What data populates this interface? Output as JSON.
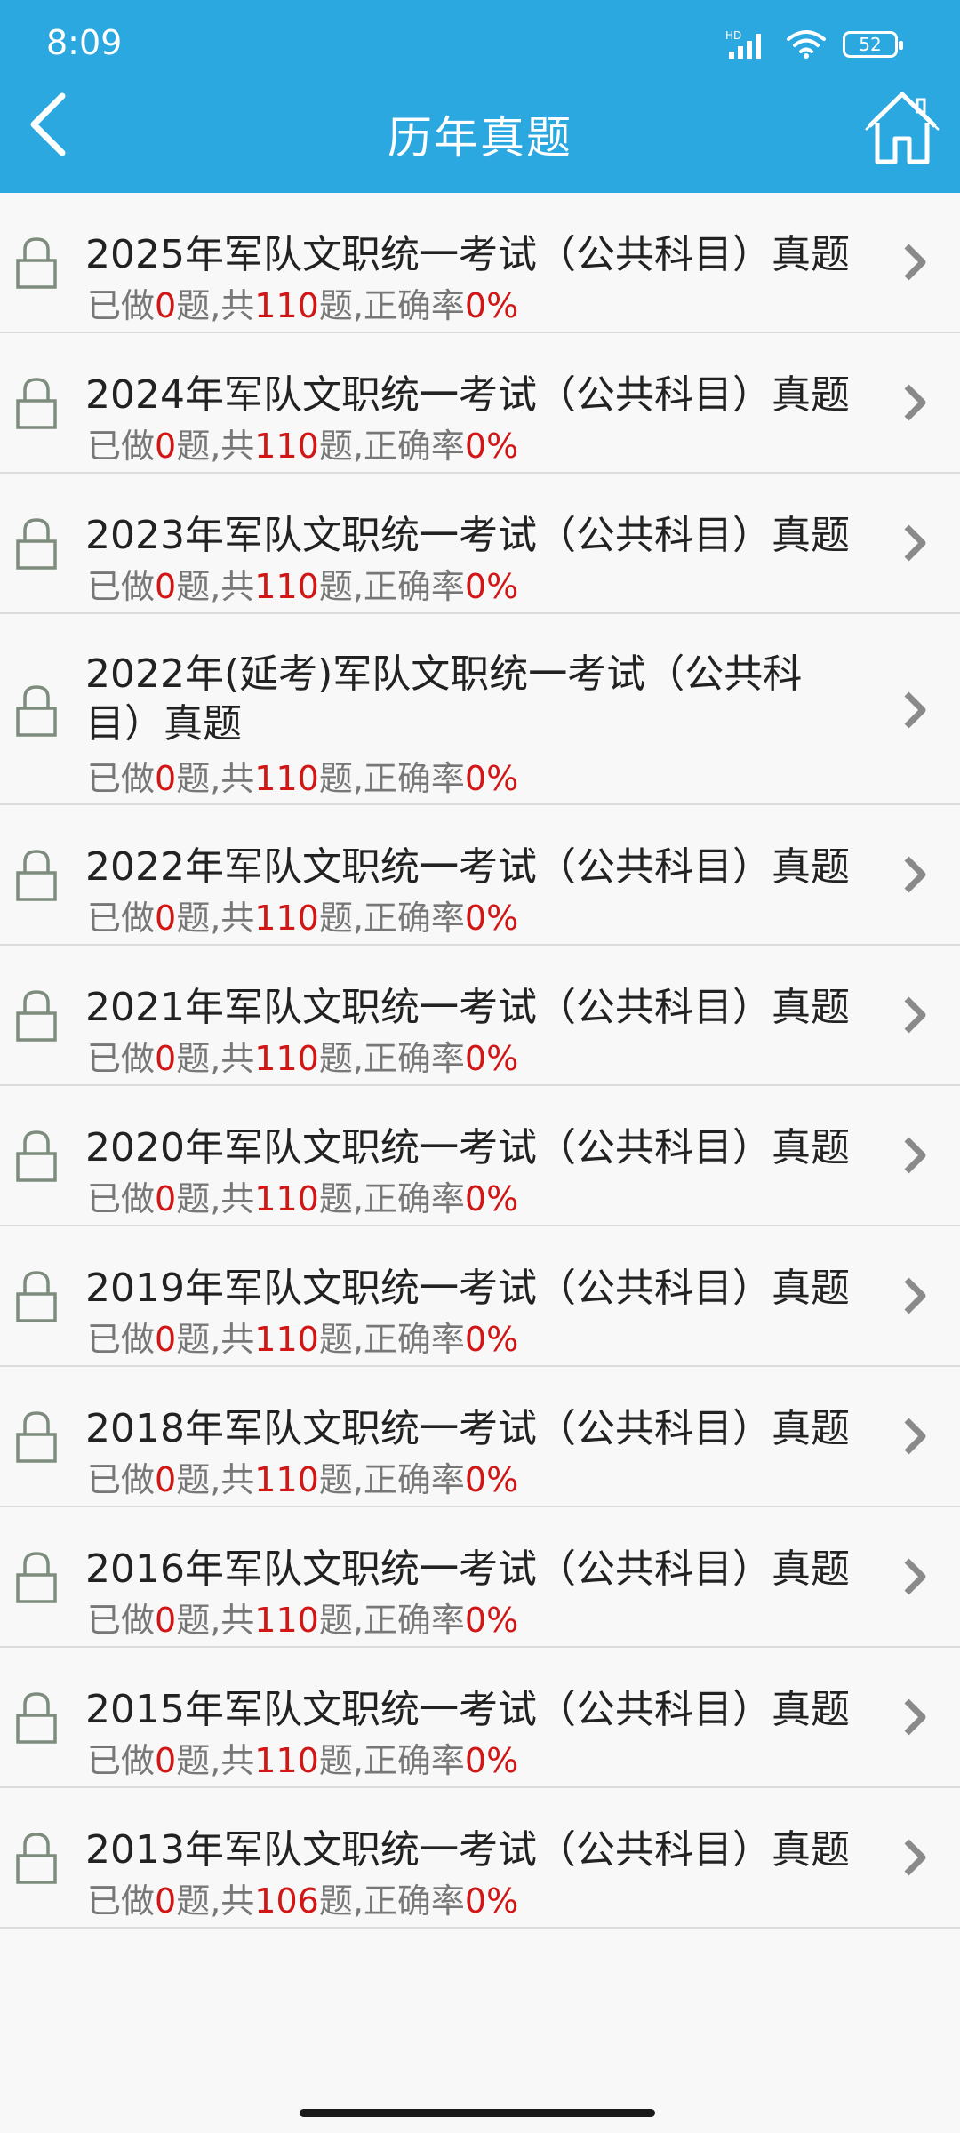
{
  "status_bar": {
    "time": "8:09",
    "signal_label": "HD",
    "battery": "52"
  },
  "header": {
    "title": "历年真题"
  },
  "stats_labels": {
    "done_prefix": "已做",
    "done_suffix": "题,共",
    "total_suffix": "题,正确率"
  },
  "exams": [
    {
      "title": "2025年军队文职统一考试（公共科目）真题",
      "done": "0",
      "total": "110",
      "accuracy": "0%"
    },
    {
      "title": "2024年军队文职统一考试（公共科目）真题",
      "done": "0",
      "total": "110",
      "accuracy": "0%"
    },
    {
      "title": "2023年军队文职统一考试（公共科目）真题",
      "done": "0",
      "total": "110",
      "accuracy": "0%"
    },
    {
      "title": "2022年(延考)军队文职统一考试（公共科目）真题",
      "done": "0",
      "total": "110",
      "accuracy": "0%"
    },
    {
      "title": "2022年军队文职统一考试（公共科目）真题",
      "done": "0",
      "total": "110",
      "accuracy": "0%"
    },
    {
      "title": "2021年军队文职统一考试（公共科目）真题",
      "done": "0",
      "total": "110",
      "accuracy": "0%"
    },
    {
      "title": "2020年军队文职统一考试（公共科目）真题",
      "done": "0",
      "total": "110",
      "accuracy": "0%"
    },
    {
      "title": "2019年军队文职统一考试（公共科目）真题",
      "done": "0",
      "total": "110",
      "accuracy": "0%"
    },
    {
      "title": "2018年军队文职统一考试（公共科目）真题",
      "done": "0",
      "total": "110",
      "accuracy": "0%"
    },
    {
      "title": "2016年军队文职统一考试（公共科目）真题",
      "done": "0",
      "total": "110",
      "accuracy": "0%"
    },
    {
      "title": "2015年军队文职统一考试（公共科目）真题",
      "done": "0",
      "total": "110",
      "accuracy": "0%"
    },
    {
      "title": "2013年军队文职统一考试（公共科目）真题",
      "done": "0",
      "total": "106",
      "accuracy": "0%"
    }
  ]
}
